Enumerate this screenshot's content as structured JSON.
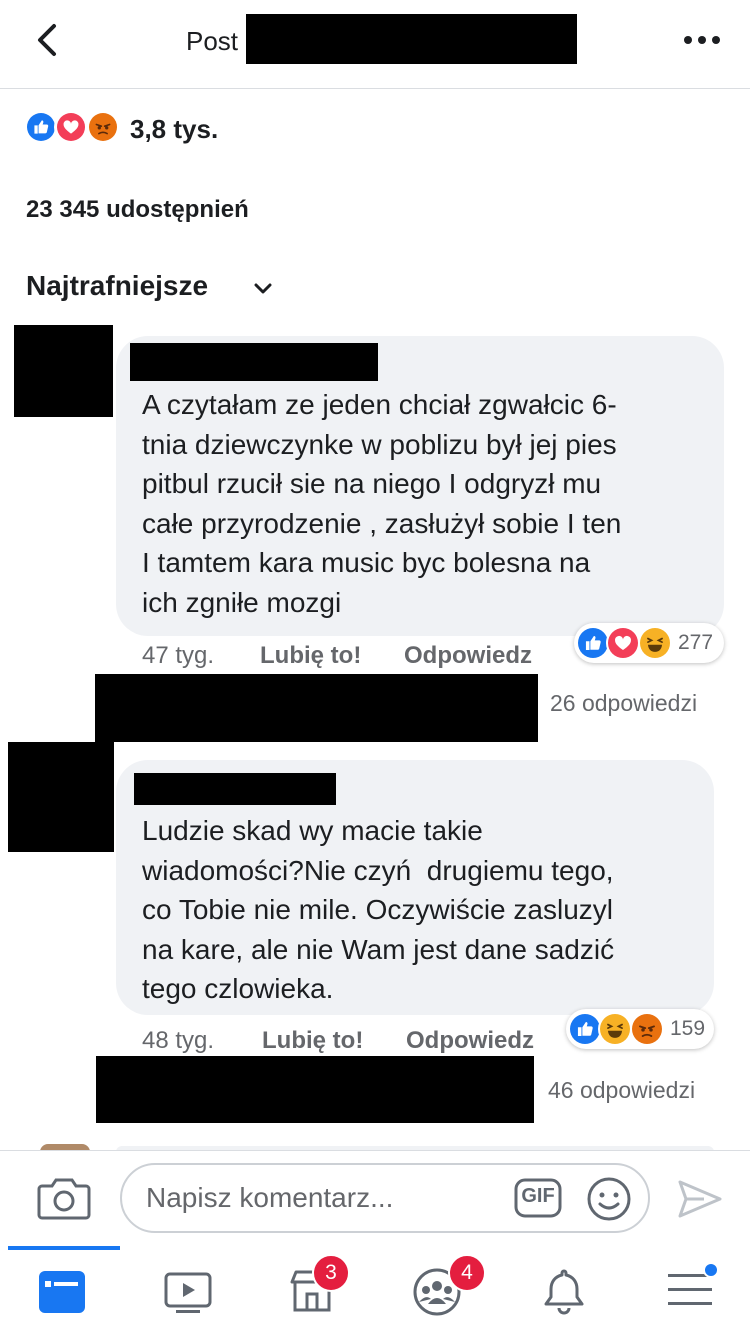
{
  "header": {
    "title": "Post"
  },
  "post": {
    "reaction_count": "3,8 tys.",
    "shares": "23 345 udostępnień"
  },
  "sort": {
    "label": "Najtrafniejsze"
  },
  "comments": [
    {
      "text": "A czytałam ze jeden chciał zgwałcic 6-tnia dziewczynke w poblizu był jej pies pitbul rzucił sie na niego I odgryzł mu całe przyrodzenie , zasłużył sobie I ten I tamtem kara music byc bolesna na ich zgniłe mozgi",
      "lines": [
        "A czytałam ze jeden chciał zgwałcic 6-",
        "tnia dziewczynke w poblizu był jej pies",
        "pitbul rzucił sie na niego I odgryzł mu",
        "całe przyrodzenie , zasłużył sobie I ten",
        "I tamtem kara music byc bolesna na",
        "ich zgniłe mozgi"
      ],
      "time": "47 tyg.",
      "like": "Lubię to!",
      "reply": "Odpowiedz",
      "reactions": [
        "like-icon",
        "love-icon",
        "haha-icon"
      ],
      "reaction_count": "277",
      "replies": "26 odpowiedzi"
    },
    {
      "text": "Ludzie skad wy macie takie wiadomości?Nie czyń drugiemu tego, co Tobie nie mile. Oczywiście zasluzyl na kare, ale nie Wam jest dane sadzić tego czlowieka.",
      "lines": [
        "Ludzie skad wy macie takie",
        "wiadomości?Nie czyń  drugiemu tego,",
        "co Tobie nie mile. Oczywiście zasluzyl",
        "na kare, ale nie Wam jest dane sadzić",
        "tego czlowieka."
      ],
      "time": "48 tyg.",
      "like": "Lubię to!",
      "reply": "Odpowiedz",
      "reactions": [
        "like-icon",
        "haha-icon",
        "angry-icon"
      ],
      "reaction_count": "159",
      "replies": "46 odpowiedzi"
    }
  ],
  "composer": {
    "placeholder": "Napisz komentarz...",
    "gif_label": "GIF"
  },
  "tabbar": {
    "marketplace_badge": "3",
    "groups_badge": "4"
  },
  "colors": {
    "accent": "#1877f2",
    "like": "#1877f2",
    "love": "#f33e58",
    "haha": "#f7b125",
    "angry": "#e9710f",
    "badge": "#e41e3f"
  },
  "icons": [
    "back-arrow-icon",
    "more-icon",
    "chevron-down-icon",
    "camera-icon",
    "gif-icon",
    "emoji-icon",
    "send-icon",
    "news-feed-icon",
    "watch-icon",
    "marketplace-icon",
    "groups-icon",
    "notifications-icon",
    "menu-icon"
  ]
}
